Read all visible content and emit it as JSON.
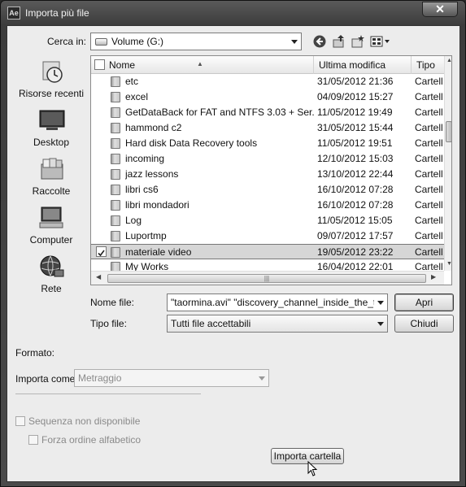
{
  "window": {
    "title": "Importa più file",
    "app_icon": "Ae",
    "close_glyph": "✕"
  },
  "toolbar": {
    "lookin_label": "Cerca in:",
    "lookin_value": "Volume (G:)",
    "icons": [
      "back-icon",
      "up-folder-icon",
      "new-folder-icon",
      "view-menu-icon"
    ]
  },
  "places": [
    {
      "label": "Risorse recenti",
      "icon": "recent-places-icon"
    },
    {
      "label": "Desktop",
      "icon": "desktop-icon"
    },
    {
      "label": "Raccolte",
      "icon": "libraries-icon"
    },
    {
      "label": "Computer",
      "icon": "computer-icon"
    },
    {
      "label": "Rete",
      "icon": "network-icon"
    }
  ],
  "columns": {
    "name": "Nome",
    "modified": "Ultima modifica",
    "type": "Tipo"
  },
  "rows": [
    {
      "name": "etc",
      "date": "31/05/2012 21:36",
      "type": "Cartell",
      "selected": false
    },
    {
      "name": "excel",
      "date": "04/09/2012 15:27",
      "type": "Cartell",
      "selected": false
    },
    {
      "name": "GetDataBack for FAT and NTFS 3.03 + Ser...",
      "date": "11/05/2012 19:49",
      "type": "Cartell",
      "selected": false
    },
    {
      "name": "hammond c2",
      "date": "31/05/2012 15:44",
      "type": "Cartell",
      "selected": false
    },
    {
      "name": "Hard disk Data Recovery tools",
      "date": "11/05/2012 19:51",
      "type": "Cartell",
      "selected": false
    },
    {
      "name": "incoming",
      "date": "12/10/2012 15:03",
      "type": "Cartell",
      "selected": false
    },
    {
      "name": "jazz lessons",
      "date": "13/10/2012 22:44",
      "type": "Cartell",
      "selected": false
    },
    {
      "name": "libri cs6",
      "date": "16/10/2012 07:28",
      "type": "Cartell",
      "selected": false
    },
    {
      "name": "libri mondadori",
      "date": "16/10/2012 07:28",
      "type": "Cartell",
      "selected": false
    },
    {
      "name": "Log",
      "date": "11/05/2012 15:05",
      "type": "Cartell",
      "selected": false
    },
    {
      "name": "Luportmp",
      "date": "09/07/2012 17:57",
      "type": "Cartell",
      "selected": false
    },
    {
      "name": "materiale video",
      "date": "19/05/2012 23:22",
      "type": "Cartell",
      "selected": true
    },
    {
      "name": "My Works",
      "date": "16/04/2012 22:01",
      "type": "Cartell",
      "selected": false
    }
  ],
  "filename": {
    "label": "Nome file:",
    "value": "\"taormina.avi\" \"discovery_channel_inside_the_twin_t",
    "open_button": "Apri"
  },
  "filetype": {
    "label": "Tipo file:",
    "value": "Tutti file accettabili",
    "close_button": "Chiudi"
  },
  "format": {
    "label": "Formato:"
  },
  "import_as": {
    "label": "Importa come:",
    "value": "Metraggio"
  },
  "options": {
    "sequence_label": "Sequenza non disponibile",
    "alphabetic_label": "Forza ordine alfabetico",
    "import_folder_button": "Importa cartella"
  }
}
